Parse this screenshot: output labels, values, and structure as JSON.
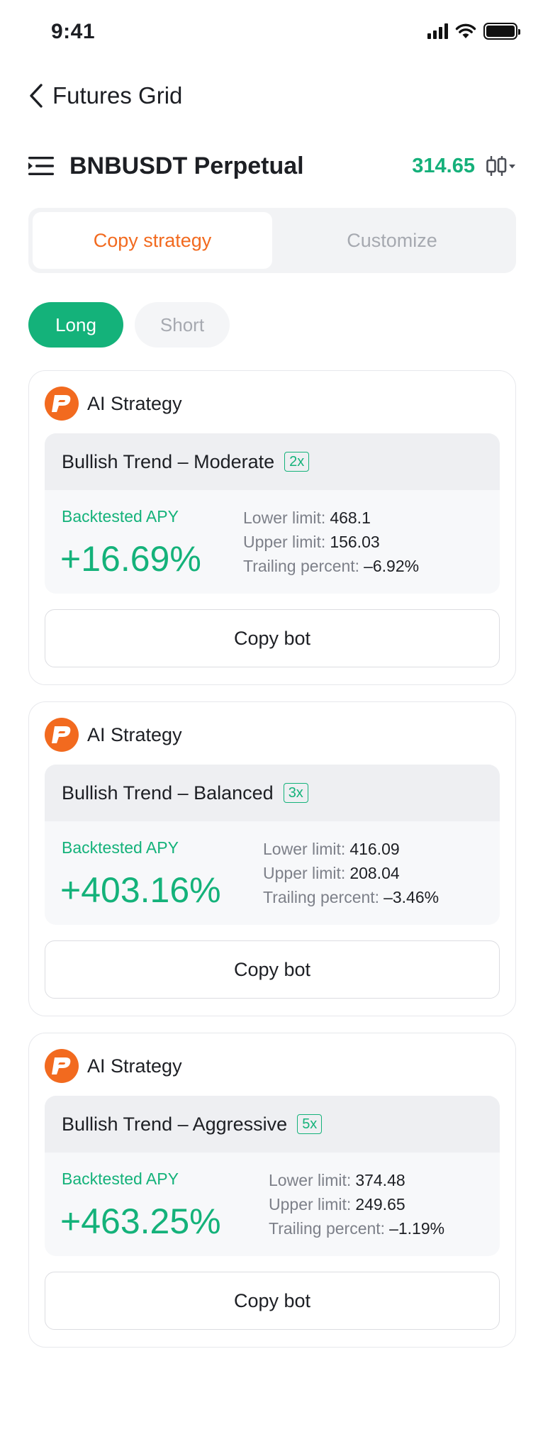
{
  "status_bar": {
    "time": "9:41"
  },
  "nav": {
    "title": "Futures Grid"
  },
  "pair": {
    "name": "BNBUSDT Perpetual",
    "price": "314.65"
  },
  "tabs": [
    {
      "label": "Copy strategy",
      "active": true
    },
    {
      "label": "Customize",
      "active": false
    }
  ],
  "direction": [
    {
      "label": "Long",
      "active": true
    },
    {
      "label": "Short",
      "active": false
    }
  ],
  "colors": {
    "accent_orange": "#f26a1f",
    "accent_green": "#14b27a"
  },
  "strategies": [
    {
      "header": "AI Strategy",
      "name": "Bullish Trend – Moderate",
      "leverage": "2x",
      "apy_label": "Backtested APY",
      "apy": "+16.69%",
      "lower_label": "Lower limit:",
      "lower": "468.1",
      "upper_label": "Upper limit:",
      "upper": "156.03",
      "trailing_label": "Trailing percent:",
      "trailing": "–6.92%",
      "button": "Copy bot"
    },
    {
      "header": "AI Strategy",
      "name": "Bullish Trend – Balanced",
      "leverage": "3x",
      "apy_label": "Backtested APY",
      "apy": "+403.16%",
      "lower_label": "Lower limit:",
      "lower": "416.09",
      "upper_label": "Upper limit:",
      "upper": "208.04",
      "trailing_label": "Trailing percent:",
      "trailing": "–3.46%",
      "button": "Copy bot"
    },
    {
      "header": "AI Strategy",
      "name": "Bullish Trend – Aggressive",
      "leverage": "5x",
      "apy_label": "Backtested APY",
      "apy": "+463.25%",
      "lower_label": "Lower limit:",
      "lower": "374.48",
      "upper_label": "Upper limit:",
      "upper": "249.65",
      "trailing_label": "Trailing percent:",
      "trailing": "–1.19%",
      "button": "Copy bot"
    }
  ]
}
